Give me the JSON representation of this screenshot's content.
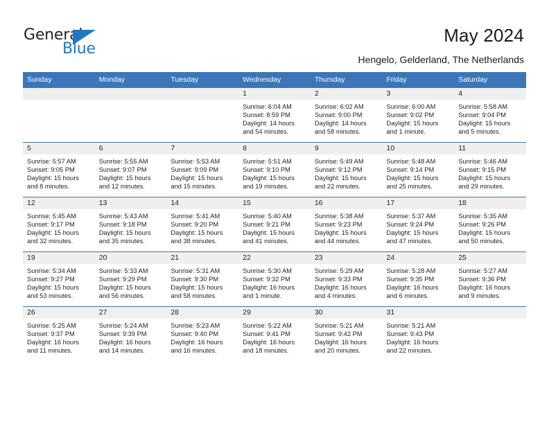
{
  "brand": {
    "name_part1": "General",
    "name_part2": "Blue",
    "accent_color": "#1f79c0"
  },
  "header": {
    "title": "May 2024",
    "subtitle": "Hengelo, Gelderland, The Netherlands",
    "header_bg_color": "#3b76b8"
  },
  "weekdays": [
    "Sunday",
    "Monday",
    "Tuesday",
    "Wednesday",
    "Thursday",
    "Friday",
    "Saturday"
  ],
  "weeks": [
    [
      {
        "day": "",
        "sunrise": "",
        "sunset": "",
        "daylight1": "",
        "daylight2": "",
        "empty": true
      },
      {
        "day": "",
        "sunrise": "",
        "sunset": "",
        "daylight1": "",
        "daylight2": "",
        "empty": true
      },
      {
        "day": "",
        "sunrise": "",
        "sunset": "",
        "daylight1": "",
        "daylight2": "",
        "empty": true
      },
      {
        "day": "1",
        "sunrise": "Sunrise: 6:04 AM",
        "sunset": "Sunset: 8:59 PM",
        "daylight1": "Daylight: 14 hours",
        "daylight2": "and 54 minutes.",
        "empty": false
      },
      {
        "day": "2",
        "sunrise": "Sunrise: 6:02 AM",
        "sunset": "Sunset: 9:00 PM",
        "daylight1": "Daylight: 14 hours",
        "daylight2": "and 58 minutes.",
        "empty": false
      },
      {
        "day": "3",
        "sunrise": "Sunrise: 6:00 AM",
        "sunset": "Sunset: 9:02 PM",
        "daylight1": "Daylight: 15 hours",
        "daylight2": "and 1 minute.",
        "empty": false
      },
      {
        "day": "4",
        "sunrise": "Sunrise: 5:58 AM",
        "sunset": "Sunset: 9:04 PM",
        "daylight1": "Daylight: 15 hours",
        "daylight2": "and 5 minutes.",
        "empty": false
      }
    ],
    [
      {
        "day": "5",
        "sunrise": "Sunrise: 5:57 AM",
        "sunset": "Sunset: 9:05 PM",
        "daylight1": "Daylight: 15 hours",
        "daylight2": "and 8 minutes.",
        "empty": false
      },
      {
        "day": "6",
        "sunrise": "Sunrise: 5:55 AM",
        "sunset": "Sunset: 9:07 PM",
        "daylight1": "Daylight: 15 hours",
        "daylight2": "and 12 minutes.",
        "empty": false
      },
      {
        "day": "7",
        "sunrise": "Sunrise: 5:53 AM",
        "sunset": "Sunset: 9:09 PM",
        "daylight1": "Daylight: 15 hours",
        "daylight2": "and 15 minutes.",
        "empty": false
      },
      {
        "day": "8",
        "sunrise": "Sunrise: 5:51 AM",
        "sunset": "Sunset: 9:10 PM",
        "daylight1": "Daylight: 15 hours",
        "daylight2": "and 19 minutes.",
        "empty": false
      },
      {
        "day": "9",
        "sunrise": "Sunrise: 5:49 AM",
        "sunset": "Sunset: 9:12 PM",
        "daylight1": "Daylight: 15 hours",
        "daylight2": "and 22 minutes.",
        "empty": false
      },
      {
        "day": "10",
        "sunrise": "Sunrise: 5:48 AM",
        "sunset": "Sunset: 9:14 PM",
        "daylight1": "Daylight: 15 hours",
        "daylight2": "and 25 minutes.",
        "empty": false
      },
      {
        "day": "11",
        "sunrise": "Sunrise: 5:46 AM",
        "sunset": "Sunset: 9:15 PM",
        "daylight1": "Daylight: 15 hours",
        "daylight2": "and 29 minutes.",
        "empty": false
      }
    ],
    [
      {
        "day": "12",
        "sunrise": "Sunrise: 5:45 AM",
        "sunset": "Sunset: 9:17 PM",
        "daylight1": "Daylight: 15 hours",
        "daylight2": "and 32 minutes.",
        "empty": false
      },
      {
        "day": "13",
        "sunrise": "Sunrise: 5:43 AM",
        "sunset": "Sunset: 9:18 PM",
        "daylight1": "Daylight: 15 hours",
        "daylight2": "and 35 minutes.",
        "empty": false
      },
      {
        "day": "14",
        "sunrise": "Sunrise: 5:41 AM",
        "sunset": "Sunset: 9:20 PM",
        "daylight1": "Daylight: 15 hours",
        "daylight2": "and 38 minutes.",
        "empty": false
      },
      {
        "day": "15",
        "sunrise": "Sunrise: 5:40 AM",
        "sunset": "Sunset: 9:21 PM",
        "daylight1": "Daylight: 15 hours",
        "daylight2": "and 41 minutes.",
        "empty": false
      },
      {
        "day": "16",
        "sunrise": "Sunrise: 5:38 AM",
        "sunset": "Sunset: 9:23 PM",
        "daylight1": "Daylight: 15 hours",
        "daylight2": "and 44 minutes.",
        "empty": false
      },
      {
        "day": "17",
        "sunrise": "Sunrise: 5:37 AM",
        "sunset": "Sunset: 9:24 PM",
        "daylight1": "Daylight: 15 hours",
        "daylight2": "and 47 minutes.",
        "empty": false
      },
      {
        "day": "18",
        "sunrise": "Sunrise: 5:35 AM",
        "sunset": "Sunset: 9:26 PM",
        "daylight1": "Daylight: 15 hours",
        "daylight2": "and 50 minutes.",
        "empty": false
      }
    ],
    [
      {
        "day": "19",
        "sunrise": "Sunrise: 5:34 AM",
        "sunset": "Sunset: 9:27 PM",
        "daylight1": "Daylight: 15 hours",
        "daylight2": "and 53 minutes.",
        "empty": false
      },
      {
        "day": "20",
        "sunrise": "Sunrise: 5:33 AM",
        "sunset": "Sunset: 9:29 PM",
        "daylight1": "Daylight: 15 hours",
        "daylight2": "and 56 minutes.",
        "empty": false
      },
      {
        "day": "21",
        "sunrise": "Sunrise: 5:31 AM",
        "sunset": "Sunset: 9:30 PM",
        "daylight1": "Daylight: 15 hours",
        "daylight2": "and 58 minutes.",
        "empty": false
      },
      {
        "day": "22",
        "sunrise": "Sunrise: 5:30 AM",
        "sunset": "Sunset: 9:32 PM",
        "daylight1": "Daylight: 16 hours",
        "daylight2": "and 1 minute.",
        "empty": false
      },
      {
        "day": "23",
        "sunrise": "Sunrise: 5:29 AM",
        "sunset": "Sunset: 9:33 PM",
        "daylight1": "Daylight: 16 hours",
        "daylight2": "and 4 minutes.",
        "empty": false
      },
      {
        "day": "24",
        "sunrise": "Sunrise: 5:28 AM",
        "sunset": "Sunset: 9:35 PM",
        "daylight1": "Daylight: 16 hours",
        "daylight2": "and 6 minutes.",
        "empty": false
      },
      {
        "day": "25",
        "sunrise": "Sunrise: 5:27 AM",
        "sunset": "Sunset: 9:36 PM",
        "daylight1": "Daylight: 16 hours",
        "daylight2": "and 9 minutes.",
        "empty": false
      }
    ],
    [
      {
        "day": "26",
        "sunrise": "Sunrise: 5:25 AM",
        "sunset": "Sunset: 9:37 PM",
        "daylight1": "Daylight: 16 hours",
        "daylight2": "and 11 minutes.",
        "empty": false
      },
      {
        "day": "27",
        "sunrise": "Sunrise: 5:24 AM",
        "sunset": "Sunset: 9:39 PM",
        "daylight1": "Daylight: 16 hours",
        "daylight2": "and 14 minutes.",
        "empty": false
      },
      {
        "day": "28",
        "sunrise": "Sunrise: 5:23 AM",
        "sunset": "Sunset: 9:40 PM",
        "daylight1": "Daylight: 16 hours",
        "daylight2": "and 16 minutes.",
        "empty": false
      },
      {
        "day": "29",
        "sunrise": "Sunrise: 5:22 AM",
        "sunset": "Sunset: 9:41 PM",
        "daylight1": "Daylight: 16 hours",
        "daylight2": "and 18 minutes.",
        "empty": false
      },
      {
        "day": "30",
        "sunrise": "Sunrise: 5:21 AM",
        "sunset": "Sunset: 9:42 PM",
        "daylight1": "Daylight: 16 hours",
        "daylight2": "and 20 minutes.",
        "empty": false
      },
      {
        "day": "31",
        "sunrise": "Sunrise: 5:21 AM",
        "sunset": "Sunset: 9:43 PM",
        "daylight1": "Daylight: 16 hours",
        "daylight2": "and 22 minutes.",
        "empty": false
      },
      {
        "day": "",
        "sunrise": "",
        "sunset": "",
        "daylight1": "",
        "daylight2": "",
        "empty": true
      }
    ]
  ]
}
